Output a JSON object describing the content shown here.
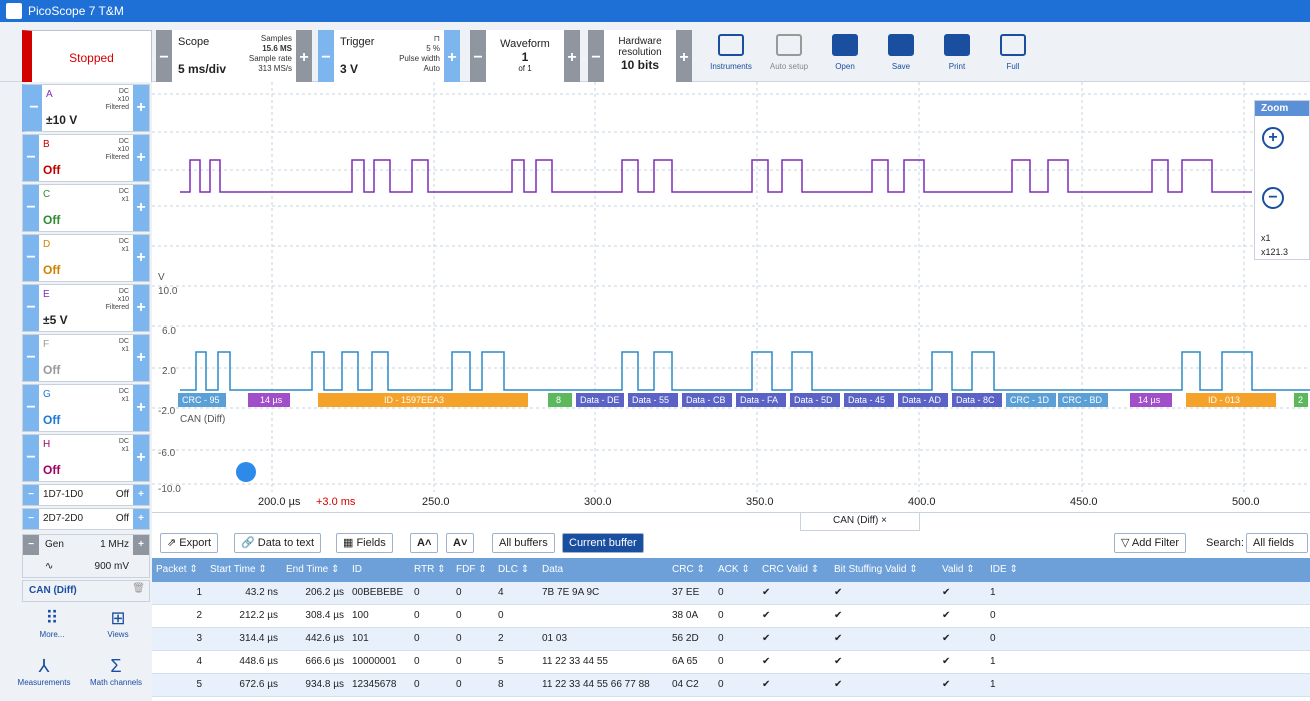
{
  "window": {
    "title": "PicoScope 7 T&M"
  },
  "toolbar": {
    "status": "Stopped",
    "scope": {
      "label": "Scope",
      "value": "5 ms/div",
      "samples_label": "Samples",
      "samples_value": "15.6 MS",
      "rate_label": "Sample rate",
      "rate_value": "313 MS/s"
    },
    "trigger": {
      "label": "Trigger",
      "value": "3 V",
      "pct": "5 %",
      "type": "Pulse width",
      "mode": "Auto"
    },
    "waveform": {
      "label": "Waveform",
      "value": "1",
      "of": "of 1"
    },
    "resolution": {
      "label1": "Hardware",
      "label2": "resolution",
      "value": "10 bits"
    },
    "icons": [
      "Instruments",
      "Auto setup",
      "Open",
      "Save",
      "Print",
      "Full"
    ]
  },
  "channels": [
    {
      "name": "A",
      "range": "±10 V",
      "s1": "DC",
      "s2": "x10",
      "s3": "Filtered",
      "color": "#7b2fb5"
    },
    {
      "name": "B",
      "range": "Off",
      "s1": "DC",
      "s2": "x10",
      "s3": "Filtered",
      "color": "#c00000"
    },
    {
      "name": "C",
      "range": "Off",
      "s1": "DC",
      "s2": "x1",
      "s3": "",
      "color": "#2e8b2e"
    },
    {
      "name": "D",
      "range": "Off",
      "s1": "DC",
      "s2": "x1",
      "s3": "",
      "color": "#d08000"
    },
    {
      "name": "E",
      "range": "±5 V",
      "s1": "DC",
      "s2": "x10",
      "s3": "Filtered",
      "color": "#7b2fb5"
    },
    {
      "name": "F",
      "range": "Off",
      "s1": "DC",
      "s2": "x1",
      "s3": "",
      "color": "#999999"
    },
    {
      "name": "G",
      "range": "Off",
      "s1": "DC",
      "s2": "x1",
      "s3": "",
      "color": "#1e78d6"
    },
    {
      "name": "H",
      "range": "Off",
      "s1": "DC",
      "s2": "x1",
      "s3": "",
      "color": "#a00060"
    }
  ],
  "digital": [
    {
      "label": "1D7-1D0",
      "state": "Off"
    },
    {
      "label": "2D7-2D0",
      "state": "Off"
    }
  ],
  "generator": {
    "label": "Gen",
    "freq": "1 MHz",
    "ampl": "900 mV"
  },
  "decoder": {
    "label": "CAN (Diff)"
  },
  "nav": [
    "More...",
    "Views",
    "Measurements",
    "Math channels"
  ],
  "zoom": {
    "title": "Zoom",
    "x": "x1",
    "y": "x121.3"
  },
  "axis": {
    "y_unit": "V",
    "y_ticks": [
      "10.0",
      "6.0",
      "2.0",
      "-2.0",
      "-6.0",
      "-10.0"
    ],
    "x_ticks": [
      "200.0 µs",
      "250.0",
      "300.0",
      "350.0",
      "400.0",
      "450.0",
      "500.0"
    ],
    "x_offset": "+3.0 ms",
    "decode_label": "CAN (Diff)"
  },
  "decode_segments": [
    "CRC - 95",
    "14 µs",
    "ID - 1597EEA3",
    "8",
    "Data - DE",
    "Data - 55",
    "Data - CB",
    "Data - FA",
    "Data - 5D",
    "Data - 45",
    "Data - AD",
    "Data - 8C",
    "CRC - 1D",
    "CRC - BD",
    "14 µs",
    "ID - 013",
    "2"
  ],
  "tabs": {
    "active": "CAN (Diff)"
  },
  "bottom": {
    "export": "Export",
    "data_to_text": "Data to text",
    "fields": "Fields",
    "all_buffers": "All buffers",
    "current_buffer": "Current buffer",
    "add_filter": "Add Filter",
    "search_label": "Search:",
    "search_value": "All fields"
  },
  "table": {
    "headers": [
      "Packet ⇕",
      "Start Time ⇕",
      "End Time ⇕",
      "ID",
      "RTR ⇕",
      "FDF ⇕",
      "DLC ⇕",
      "Data",
      "CRC ⇕",
      "ACK ⇕",
      "CRC Valid ⇕",
      "Bit Stuffing Valid ⇕",
      "Valid ⇕",
      "IDE ⇕"
    ],
    "rows": [
      [
        "1",
        "43.2 ns",
        "206.2 µs",
        "00BEBEBE",
        "0",
        "0",
        "4",
        "7B 7E 9A 9C",
        "37 EE",
        "0",
        "✔",
        "✔",
        "✔",
        "1"
      ],
      [
        "2",
        "212.2 µs",
        "308.4 µs",
        "100",
        "0",
        "0",
        "0",
        "",
        "38 0A",
        "0",
        "✔",
        "✔",
        "✔",
        "0"
      ],
      [
        "3",
        "314.4 µs",
        "442.6 µs",
        "101",
        "0",
        "0",
        "2",
        "01 03",
        "56 2D",
        "0",
        "✔",
        "✔",
        "✔",
        "0"
      ],
      [
        "4",
        "448.6 µs",
        "666.6 µs",
        "10000001",
        "0",
        "0",
        "5",
        "11 22 33 44 55",
        "6A 65",
        "0",
        "✔",
        "✔",
        "✔",
        "1"
      ],
      [
        "5",
        "672.6 µs",
        "934.8 µs",
        "12345678",
        "0",
        "0",
        "8",
        "11 22 33 44 55 66 77 88",
        "04 C2",
        "0",
        "✔",
        "✔",
        "✔",
        "1"
      ]
    ]
  }
}
